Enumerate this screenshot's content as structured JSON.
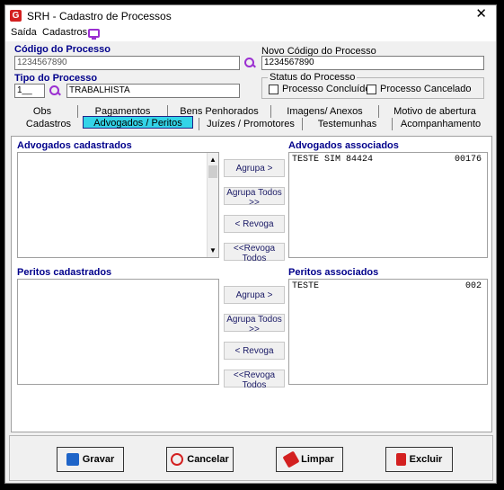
{
  "window": {
    "title": "SRH - Cadastro de Processos"
  },
  "menu": {
    "items": [
      "Saída",
      "Cadastros"
    ]
  },
  "form": {
    "codigo_label": "Código do Processo",
    "codigo_value": "1234567890",
    "novo_codigo_label": "Novo Código do Processo",
    "novo_codigo_value": "1234567890",
    "tipo_label": "Tipo do Processo",
    "tipo_code": "1__",
    "tipo_desc": "TRABALHISTA",
    "status_title": "Status do Processo",
    "status_concluido": "Processo Concluído",
    "status_cancelado": "Processo Cancelado"
  },
  "tabs_row1": [
    "Obs",
    "Pagamentos",
    "Bens Penhorados",
    "Imagens/ Anexos",
    "Motivo de abertura"
  ],
  "tabs_row2": [
    "Cadastros",
    "Advogados / Peritos",
    "Juízes / Promotores",
    "Testemunhas",
    "Acompanhamento"
  ],
  "advogados": {
    "cadastrados_label": "Advogados cadastrados",
    "associados_label": "Advogados associados",
    "btn_agrupa": "Agrupa >",
    "btn_agrupa_todos": "Agrupa Todos >>",
    "btn_revoga": "< Revoga",
    "btn_revoga_todos": "<<Revoga Todos",
    "associados": [
      {
        "name": "TESTE SIM 84424",
        "code": "00176"
      }
    ]
  },
  "peritos": {
    "cadastrados_label": "Peritos cadastrados",
    "associados_label": "Peritos associados",
    "btn_agrupa": "Agrupa >",
    "btn_agrupa_todos": "Agrupa Todos >>",
    "btn_revoga": "< Revoga",
    "btn_revoga_todos": "<<Revoga Todos",
    "associados": [
      {
        "name": "TESTE",
        "code": "002"
      }
    ]
  },
  "actions": {
    "gravar": "Gravar",
    "cancelar": "Cancelar",
    "limpar": "Limpar",
    "excluir": "Excluir"
  }
}
